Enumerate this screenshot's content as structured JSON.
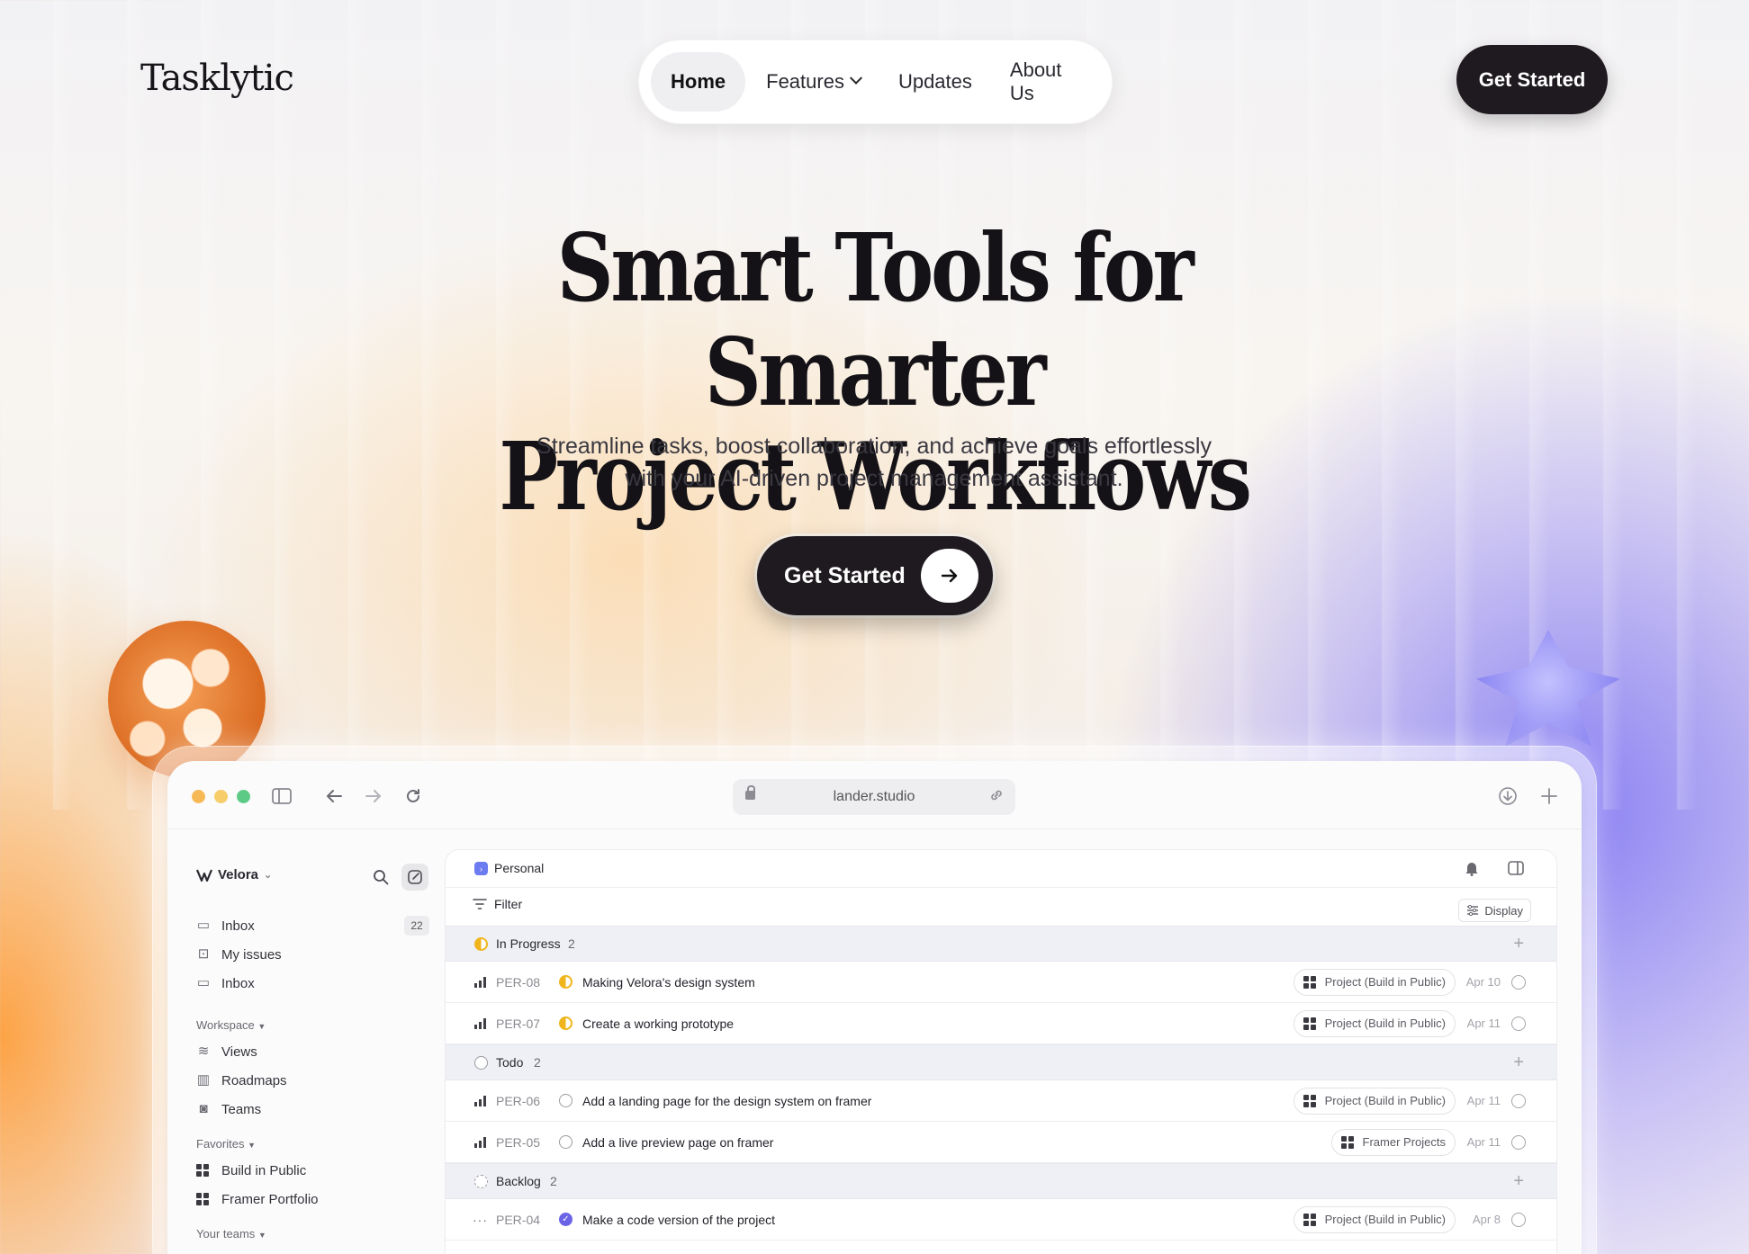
{
  "header": {
    "logo": "Tasklytic",
    "nav": [
      {
        "label": "Home",
        "active": true
      },
      {
        "label": "Features",
        "has_dropdown": true
      },
      {
        "label": "Updates"
      },
      {
        "label": "About Us"
      }
    ],
    "cta_label": "Get Started"
  },
  "hero": {
    "title_line1": "Smart Tools for Smarter",
    "title_line2": "Project Workflows",
    "subtitle_line1": "Streamline tasks, boost collaboration, and achieve goals effortlessly",
    "subtitle_line2": "with your AI-driven project management assistant.",
    "cta_label": "Get Started"
  },
  "browser": {
    "url": "lander.studio",
    "traffic_lights": [
      "#f7b955",
      "#f6cd6a",
      "#5dca86"
    ]
  },
  "sidebar": {
    "workspace_name": "Velora",
    "items_top": [
      {
        "label": "Inbox",
        "count": "22",
        "icon": "inbox-icon"
      },
      {
        "label": "My issues",
        "icon": "issues-icon"
      },
      {
        "label": "Inbox",
        "icon": "inbox-icon"
      }
    ],
    "workspace_heading": "Workspace",
    "workspace_items": [
      {
        "label": "Views",
        "icon": "layers-icon"
      },
      {
        "label": "Roadmaps",
        "icon": "map-icon"
      },
      {
        "label": "Teams",
        "icon": "team-icon"
      }
    ],
    "favorites_heading": "Favorites",
    "favorites_items": [
      {
        "label": "Build in Public"
      },
      {
        "label": "Framer Portfolio"
      }
    ],
    "teams_heading": "Your teams"
  },
  "panel": {
    "title": "Personal",
    "filter_label": "Filter",
    "display_label": "Display",
    "groups": [
      {
        "name": "In Progress",
        "count": "2"
      },
      {
        "name": "Todo",
        "count": "2"
      },
      {
        "name": "Backlog",
        "count": "2"
      }
    ],
    "tasks": [
      {
        "id": "PER-08",
        "title": "Making Velora's design system",
        "project": "Project (Build in Public)",
        "date": "Apr 10",
        "status": "in-progress"
      },
      {
        "id": "PER-07",
        "title": "Create a working prototype",
        "project": "Project (Build in Public)",
        "date": "Apr 11",
        "status": "in-progress"
      },
      {
        "id": "PER-06",
        "title": "Add a landing page for the design system on framer",
        "project": "Project (Build in Public)",
        "date": "Apr 11",
        "status": "todo"
      },
      {
        "id": "PER-05",
        "title": "Add a live preview page on framer",
        "project": "Framer Projects",
        "date": "Apr 11",
        "status": "todo"
      },
      {
        "id": "PER-04",
        "title": "Make a code version of the project",
        "project": "Project (Build in Public)",
        "date": "Apr 8",
        "status": "done"
      }
    ]
  },
  "colors": {
    "primary_dark": "#1f1a1f",
    "progress_yellow": "#f0b51c",
    "done_purple": "#6b63e6"
  }
}
